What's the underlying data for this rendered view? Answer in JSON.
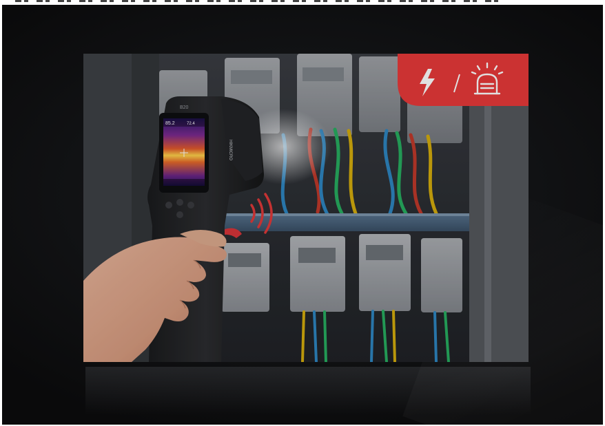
{
  "scene": {
    "subject": "handheld-thermal-camera-in-hand",
    "background": "electrical-meter-cabinet",
    "device_model_text": "B20",
    "device_brand_text": "HIKMICRO",
    "screen_readout_top_left": "85.2",
    "screen_readout_top_right": "72.4"
  },
  "badge": {
    "icons": [
      "lightning-bolt-icon",
      "slash-divider-icon",
      "alarm-siren-icon"
    ],
    "color": "#e8393a"
  },
  "colors": {
    "page_background": "#ffffff",
    "backdrop": "#111214",
    "badge_red": "#e8393a",
    "signal_red": "#e03a3a"
  }
}
